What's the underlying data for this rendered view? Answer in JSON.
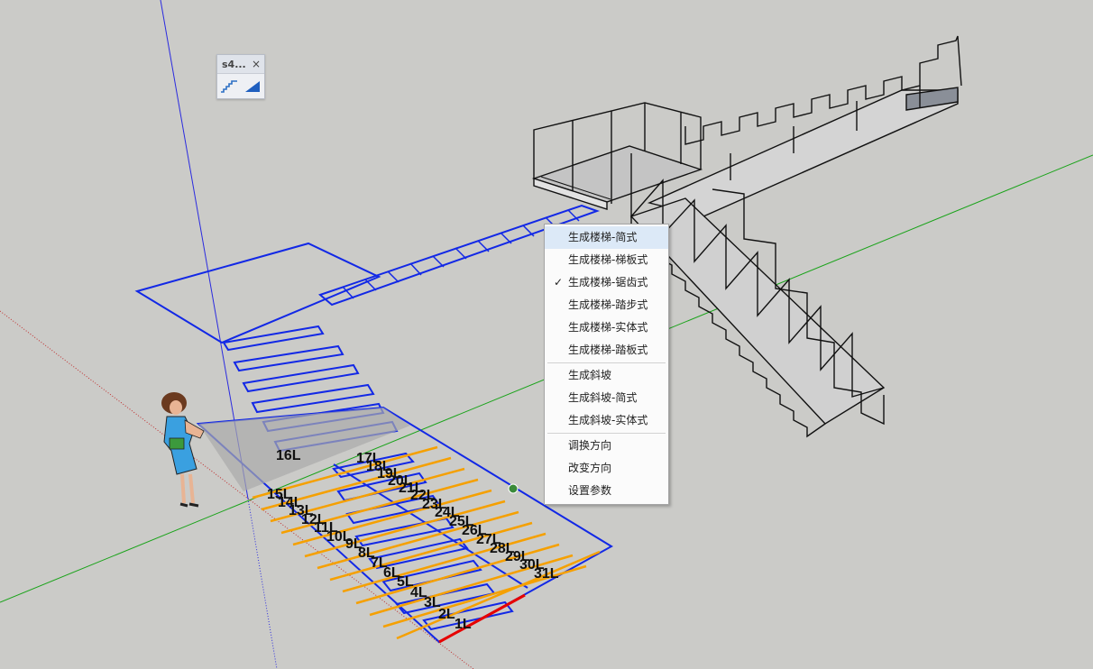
{
  "toolbar": {
    "title": "s4...",
    "close_glyph": "×",
    "buttons": [
      {
        "icon": "stairs-icon"
      },
      {
        "icon": "ramp-icon"
      }
    ]
  },
  "context_menu": {
    "groups": [
      [
        {
          "label": "生成楼梯-简式",
          "highlighted": true
        },
        {
          "label": "生成楼梯-梯板式"
        },
        {
          "label": "生成楼梯-锯齿式",
          "checked": true,
          "check_glyph": "✓"
        },
        {
          "label": "生成楼梯-踏步式"
        },
        {
          "label": "生成楼梯-实体式"
        },
        {
          "label": "生成楼梯-踏板式"
        }
      ],
      [
        {
          "label": "生成斜坡"
        },
        {
          "label": "生成斜坡-简式"
        },
        {
          "label": "生成斜坡-实体式"
        }
      ],
      [
        {
          "label": "调换方向"
        },
        {
          "label": "改变方向"
        },
        {
          "label": "设置参数"
        }
      ]
    ]
  },
  "step_labels": [
    "1L",
    "2L",
    "3L",
    "4L",
    "5L",
    "6L",
    "7L",
    "8L",
    "9L",
    "10L",
    "11L",
    "12L",
    "13L",
    "14L",
    "15L",
    "16L",
    "17L",
    "18L",
    "19L",
    "20L",
    "21L",
    "22L",
    "23L",
    "24L",
    "25L",
    "26L",
    "27L",
    "28L",
    "29L",
    "30L",
    "31L"
  ],
  "colors": {
    "background": "#cbcbc8",
    "outline_blue": "#1228e6",
    "edge_orange": "#f5a000",
    "edge_red": "#e60000",
    "axis_green": "#1aa31a",
    "axis_red": "#c03030",
    "axis_blue": "#2a2adf",
    "stair_fill": "#d4d4d4",
    "stair_line": "#111111",
    "menu_highlight": "#dce9f7"
  }
}
